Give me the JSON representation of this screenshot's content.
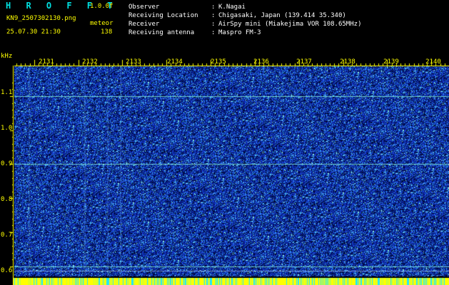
{
  "header": {
    "app_name": "H R O F F T",
    "version": "1.0.0f",
    "filename": "KN9_2507302130.png",
    "mode": "meteor",
    "datetime": "25.07.30 21:30",
    "count": "138",
    "info": [
      {
        "label": "Observer",
        "sep": ":",
        "value": "K.Nagai"
      },
      {
        "label": "Receiving Location",
        "sep": ":",
        "value": "Chigasaki, Japan (139.414 35.340)"
      },
      {
        "label": "Receiver",
        "sep": ":",
        "value": "AirSpy mini (Miakejima VOR 108.65MHz)"
      },
      {
        "label": "Receiving antenna",
        "sep": ":",
        "value": "Maspro FM-3"
      }
    ]
  },
  "spectrogram": {
    "y_unit": "kHz",
    "x_ticks": [
      "2131",
      "2132",
      "2133",
      "2134",
      "2135",
      "2136",
      "2137",
      "2138",
      "2139",
      "2140"
    ],
    "y_ticks": [
      "1.1",
      "1.0",
      "0.9",
      "0.8",
      "0.7",
      "0.6"
    ],
    "y_range_khz": [
      0.57,
      1.19
    ],
    "x_range": [
      2130.55,
      2140.4
    ],
    "horizontal_lines_khz": [
      1.1,
      0.9,
      0.6
    ],
    "colors": {
      "background": "#000000",
      "noise_base": "#0a1ca0",
      "noise_mid": "#1e46d2",
      "noise_hi": "#50c8ff",
      "accent_text": "#ffff00",
      "title_text": "#00e0e0"
    }
  }
}
